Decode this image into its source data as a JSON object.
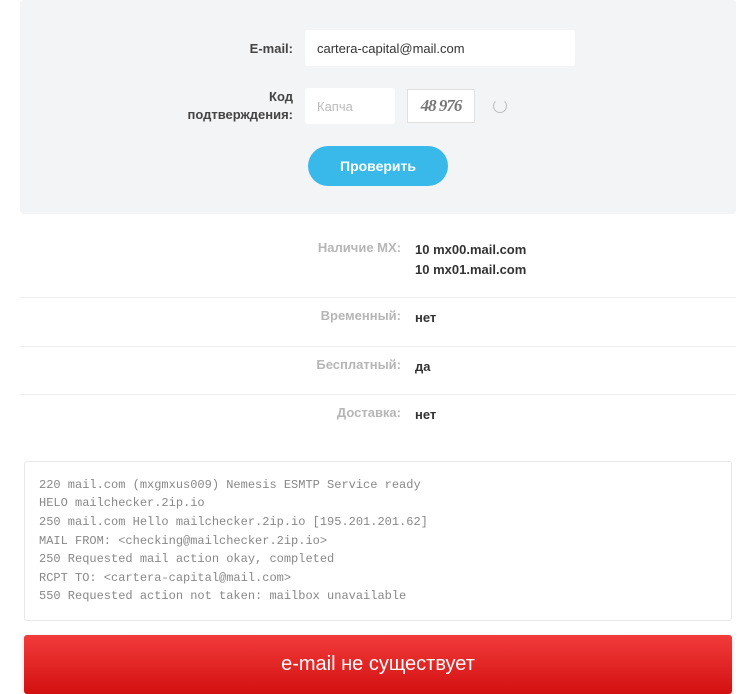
{
  "form": {
    "email_label": "E-mail:",
    "email_value": "cartera-capital@mail.com",
    "captcha_label": "Код подтверждения:",
    "captcha_placeholder": "Капча",
    "captcha_value": "48 976",
    "submit_label": "Проверить"
  },
  "results": {
    "mx_label": "Наличие MX:",
    "mx_records": [
      {
        "priority": "10",
        "host": "mx00.mail.com"
      },
      {
        "priority": "10",
        "host": "mx01.mail.com"
      }
    ],
    "temporary_label": "Временный:",
    "temporary_value": "нет",
    "free_label": "Бесплатный:",
    "free_value": "да",
    "delivery_label": "Доставка:",
    "delivery_value": "нет"
  },
  "log": "220 mail.com (mxgmxus009) Nemesis ESMTP Service ready\nHELO mailchecker.2ip.io\n250 mail.com Hello mailchecker.2ip.io [195.201.201.62]\nMAIL FROM: <checking@mailchecker.2ip.io>\n250 Requested mail action okay, completed\nRCPT TO: <cartera-capital@mail.com>\n550 Requested action not taken: mailbox unavailable",
  "status": {
    "message": "e-mail не существует",
    "color": "#e61919"
  }
}
